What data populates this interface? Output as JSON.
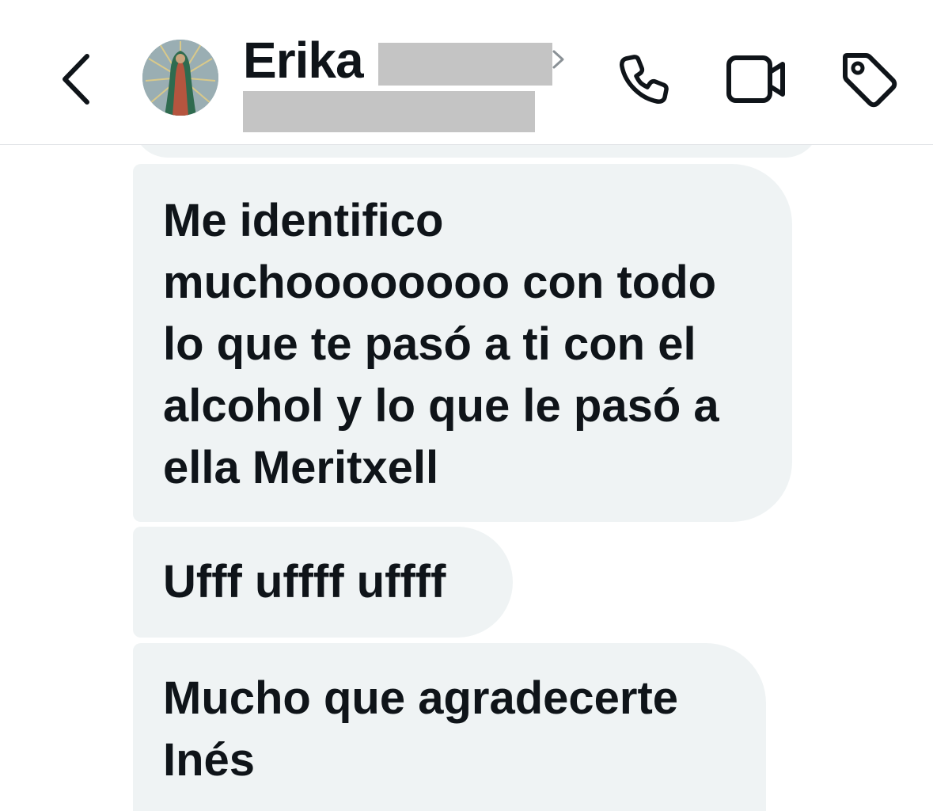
{
  "header": {
    "back_icon": "chevron-left-icon",
    "contact_name": "Erika",
    "call_icon": "phone-icon",
    "video_icon": "video-camera-icon",
    "tag_icon": "tag-icon",
    "text_color": "#0f1419",
    "redaction_color": "#c4c4c4"
  },
  "messages": [
    {
      "text": "Me identifico\nmuchoooooooo con todo\nlo que te pasó a ti con el\nalcohol y lo que le pasó a\nella Meritxell"
    },
    {
      "text": "Ufff uffff uffff"
    },
    {
      "text": "Mucho que agradecerte\nInés"
    }
  ],
  "colors": {
    "bubble_background": "#eff3f4",
    "header_border": "#e3e5e8"
  }
}
